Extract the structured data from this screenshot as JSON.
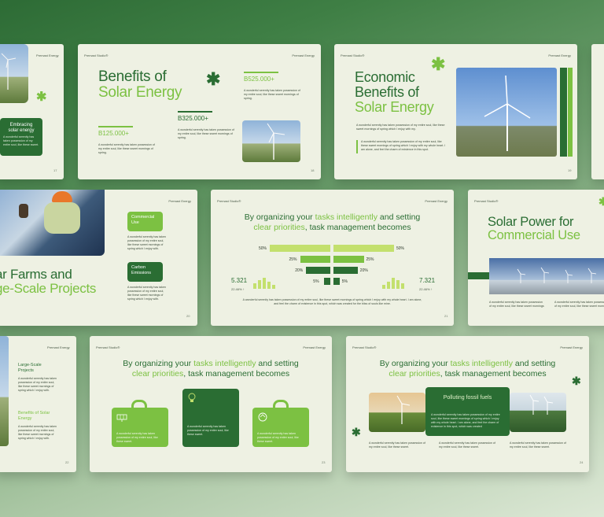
{
  "colors": {
    "dark_green": "#2a6d33",
    "light_green": "#7cc142",
    "lime": "#c3e06d",
    "slide_bg": "#eef1e3"
  },
  "common": {
    "brand": "Premast Studio®",
    "product": "Premast Energy",
    "para_short": "A wonderful serenity has taken possession of my entire soul, like these sweet mornings of spring.",
    "para_med": "A wonderful serenity has taken possession of my entire soul, like these sweet mornings of spring which I enjoy with my.",
    "para_long": "A wonderful serenity has taken possession of my entire soul, like these sweet mornings of spring which I enjoy with my whole heart. I am alone, and feel the charm of existence in this spot.",
    "para_full": "A wonderful serenity has taken possession of my entire soul, like these sweet mornings of spring which I enjoy with my whole heart. I am alone, and feel the charm of existence in this spot, which was created for the bliss of souls like mine.",
    "para_which": "A wonderful serenity has taken possession of my entire soul, like these sweet mornings of spring which I enjoy with.",
    "para_sweet": "A wonderful serenity has taken possession of my entire soul, like these sweet.",
    "para_mornings": "A wonderful serenity has taken possession of my entire soul, like these sweet mornings",
    "para_sweet_short": "A wonderful serenity has taken possession of my entire soul, like these sweet.",
    "para_whole": "A wonderful serenity has taken possession of my entire soul, like these sweet mornings of spring which I enjoy with my whole heart. I am alone, and feel the charm of existence in this spot, which was created"
  },
  "slide_a": {
    "callout": "Embracing solar energy",
    "page": "17"
  },
  "slide_b": {
    "title_1": "Benefits of",
    "title_2": "Solar Energy",
    "stat_1": "B525.000+",
    "stat_2": "B325.000+",
    "stat_3": "B125.000+",
    "page": "18"
  },
  "slide_c": {
    "title_1": "Economic",
    "title_2": "Benefits of",
    "title_3": "Solar Energy",
    "page": "19"
  },
  "slide_d": {
    "title_1": "ar Farms and",
    "title_2": "ge-Scale Projects",
    "box_1": "Commercial Use",
    "box_2": "Carbon Emissions",
    "page": "20"
  },
  "slide_e": {
    "head_a": "By organizing your ",
    "head_b": "tasks intelligently",
    "head_c": " and setting",
    "head_d": "clear priorities",
    "head_e": ", task management becomes",
    "left_stat": "5.321",
    "left_sub": "22.46% ↑",
    "right_stat": "7.321",
    "right_sub": "22.46% ↑",
    "page": "21"
  },
  "bars_left": [
    {
      "label": "50%",
      "value": 50
    },
    {
      "label": "25%",
      "value": 25
    },
    {
      "label": "20%",
      "value": 20
    },
    {
      "label": "5%",
      "value": 5
    }
  ],
  "bars_right": [
    {
      "label": "50%",
      "value": 50
    },
    {
      "label": "25%",
      "value": 25
    },
    {
      "label": "20%",
      "value": 20
    },
    {
      "label": "5%",
      "value": 5
    }
  ],
  "slide_f": {
    "title_1": "Solar Power for",
    "title_2": "Commercial Use"
  },
  "slide_g": {
    "item_1": "Large-Scale Projects",
    "item_2": "Benefits of Solar Energy",
    "page": "22"
  },
  "slide_h": {
    "head_a": "By organizing your ",
    "head_b": "tasks intelligently",
    "head_c": " and setting",
    "head_d": "clear priorities",
    "head_e": ", task management becomes",
    "page": "23"
  },
  "slide_i": {
    "head_a": "By organizing your ",
    "head_b": "tasks intelligently",
    "head_c": " and setting",
    "head_d": "clear priorities",
    "head_e": ", task management becomes",
    "card": "Polluting fossil fuels",
    "page": "24"
  }
}
